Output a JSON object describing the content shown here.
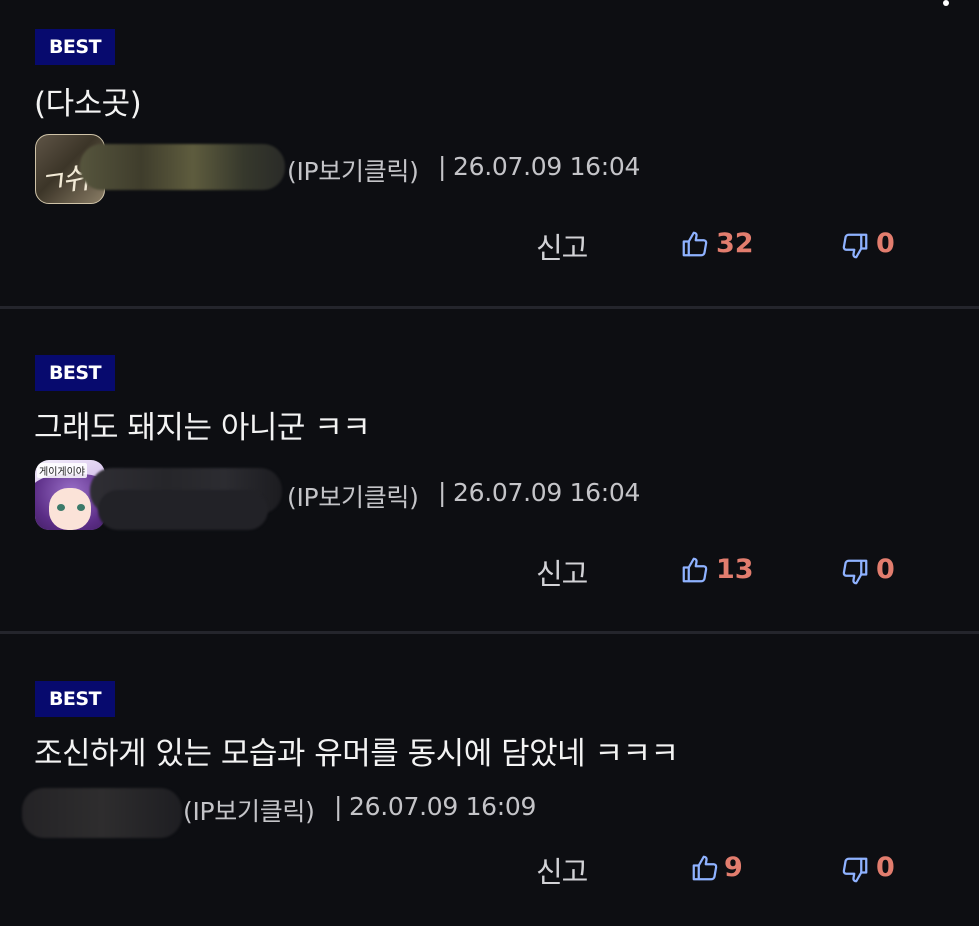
{
  "colors": {
    "background": "#0d0e12",
    "best_badge": "#070a6e",
    "vote_count": "#e27d6e",
    "vote_icon": "#8fb2ff",
    "divider": "#24252c"
  },
  "comments": [
    {
      "badge": "BEST",
      "text": "(다소곳)",
      "ip_label": "(IP보기클릭)",
      "separator": "|",
      "timestamp": "26.07.09 16:04",
      "avatar_icon": "avatar-calligraphy-icon",
      "report_label": "신고",
      "likes": "32",
      "dislikes": "0"
    },
    {
      "badge": "BEST",
      "text": "그래도 돼지는 아니군 ㅋㅋ",
      "ip_label": "(IP보기클릭)",
      "separator": "|",
      "timestamp": "26.07.09 16:04",
      "avatar_icon": "avatar-anime-girl-icon",
      "avatar_tag": "게이게이야",
      "report_label": "신고",
      "likes": "13",
      "dislikes": "0"
    },
    {
      "badge": "BEST",
      "text": "조신하게 있는 모습과 유머를 동시에 담았네 ㅋㅋㅋ",
      "ip_label": "(IP보기클릭)",
      "separator": "|",
      "timestamp": "26.07.09 16:09",
      "report_label": "신고",
      "likes": "9",
      "dislikes": "0"
    }
  ]
}
